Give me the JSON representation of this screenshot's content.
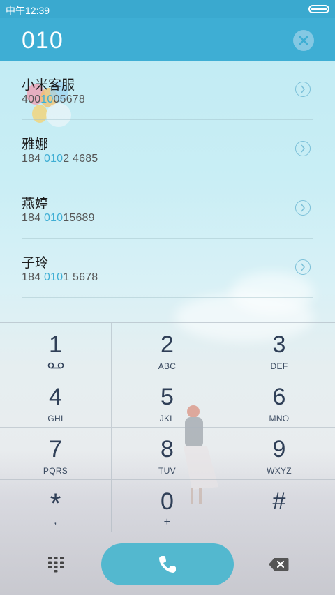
{
  "status_bar": {
    "time": "中午12:39"
  },
  "dial": {
    "number": "010"
  },
  "contacts": [
    {
      "name": "小米客服",
      "num_pre": "400",
      "num_match": "10",
      "num_post": "05678"
    },
    {
      "name": "雅娜",
      "num_pre": "184 ",
      "num_match": "010",
      "num_post": "2 4685"
    },
    {
      "name": "燕婷",
      "num_pre": "184 ",
      "num_match": "010",
      "num_post": "15689"
    },
    {
      "name": "子玲",
      "num_pre": "184 ",
      "num_match": "010",
      "num_post": "1 5678"
    }
  ],
  "keypad": {
    "k1": {
      "digit": "1",
      "letters": ""
    },
    "k2": {
      "digit": "2",
      "letters": "ABC"
    },
    "k3": {
      "digit": "3",
      "letters": "DEF"
    },
    "k4": {
      "digit": "4",
      "letters": "GHI"
    },
    "k5": {
      "digit": "5",
      "letters": "JKL"
    },
    "k6": {
      "digit": "6",
      "letters": "MNO"
    },
    "k7": {
      "digit": "7",
      "letters": "PQRS"
    },
    "k8": {
      "digit": "8",
      "letters": "TUV"
    },
    "k9": {
      "digit": "9",
      "letters": "WXYZ"
    },
    "kstar": {
      "digit": "*",
      "letters": ","
    },
    "k0": {
      "digit": "0",
      "letters": "+"
    },
    "khash": {
      "digit": "#",
      "letters": ""
    }
  },
  "icons": {
    "clear": "clear-icon",
    "chevron": "chevron-right-icon",
    "voicemail": "voicemail-icon",
    "dialpad": "dialpad-icon",
    "call": "phone-icon",
    "backspace": "backspace-icon"
  },
  "colors": {
    "accent": "#3eaed4",
    "call": "#53b8cf",
    "key_text": "#2f3f57"
  }
}
